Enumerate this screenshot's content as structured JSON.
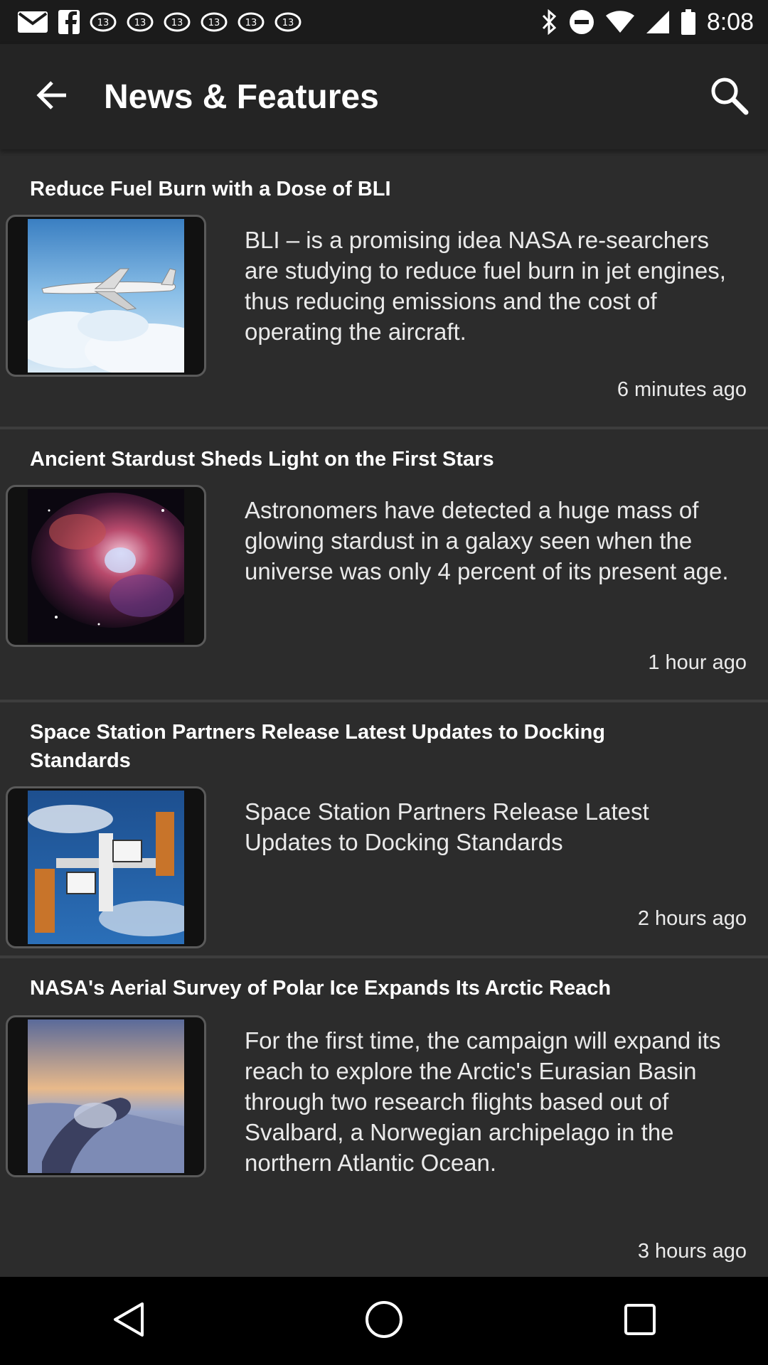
{
  "status_bar": {
    "time": "8:08",
    "icons": [
      "mail-icon",
      "facebook-icon",
      "carrier-13-icon",
      "carrier-13-icon",
      "carrier-13-icon",
      "carrier-13-icon",
      "carrier-13-icon",
      "carrier-13-icon",
      "bluetooth-icon",
      "dnd-icon",
      "wifi-icon",
      "signal-icon",
      "battery-icon"
    ]
  },
  "app_bar": {
    "title": "News & Features",
    "back_icon": "arrow-back-icon",
    "search_icon": "search-icon"
  },
  "articles": [
    {
      "title": "Reduce Fuel Burn with a Dose of BLI",
      "description": "BLI – is a promising idea NASA re-searchers are studying to reduce fuel burn in jet engines, thus reducing emissions and the cost of operating the aircraft.",
      "time": "6 minutes ago",
      "image": "airplane-in-sky"
    },
    {
      "title": "Ancient Stardust Sheds Light on the First Stars",
      "description": "Astronomers have detected a huge mass of glowing stardust in a galaxy seen when the universe was only 4 percent of its present age.",
      "time": "1 hour ago",
      "image": "nebula"
    },
    {
      "title": "Space Station Partners Release Latest Updates to Docking Standards",
      "description": "Space Station Partners Release Latest Updates to Docking Standards",
      "time": "2 hours ago",
      "image": "space-station-over-earth"
    },
    {
      "title": "NASA's Aerial Survey of Polar Ice Expands Its Arctic Reach",
      "description": "For the first time, the campaign will expand its reach to explore the Arctic's Eurasian Basin through two research flights based out of Svalbard, a Norwegian archipelago in the northern Atlantic Ocean.",
      "time": "3 hours ago",
      "image": "aircraft-wing-at-dusk"
    }
  ],
  "nav_bar": {
    "icons": [
      "back-triangle-icon",
      "home-circle-icon",
      "recents-square-icon"
    ]
  }
}
